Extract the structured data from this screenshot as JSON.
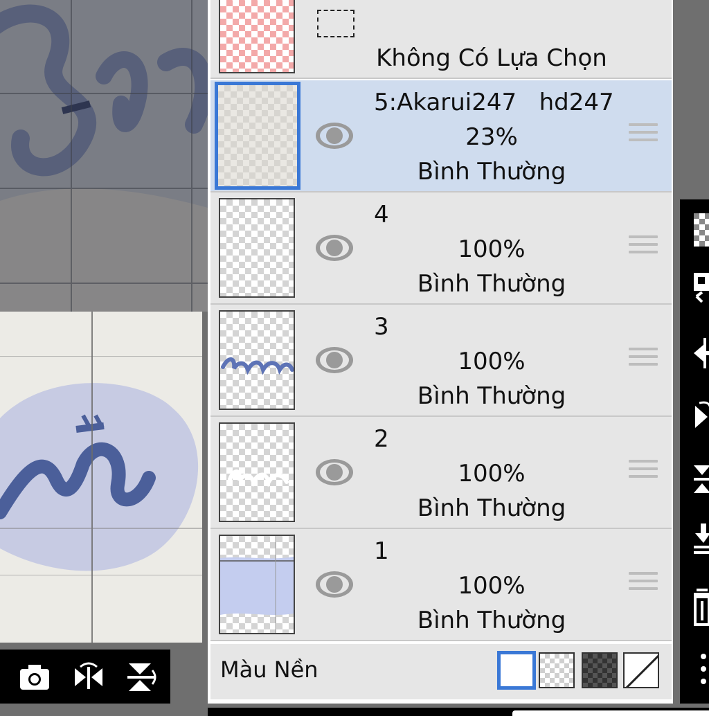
{
  "selection_row": {
    "label": "Không Có Lựa Chọn"
  },
  "layers": [
    {
      "name": "5:Akarui247   hd247",
      "opacity": "23%",
      "blend": "Bình Thường",
      "visible": true,
      "selected": true
    },
    {
      "name": "4",
      "opacity": "100%",
      "blend": "Bình Thường",
      "visible": true,
      "selected": false
    },
    {
      "name": "3",
      "opacity": "100%",
      "blend": "Bình Thường",
      "visible": true,
      "selected": false
    },
    {
      "name": "2",
      "opacity": "100%",
      "blend": "Bình Thường",
      "visible": true,
      "selected": false
    },
    {
      "name": "1",
      "opacity": "100%",
      "blend": "Bình Thường",
      "visible": true,
      "selected": false
    }
  ],
  "background": {
    "label": "Màu Nền",
    "options": [
      "white",
      "transparent-light",
      "transparent-dark",
      "none"
    ],
    "selected": "white"
  },
  "canvas_toolbar": {
    "icons": [
      "camera-icon",
      "flip-horizontal-icon",
      "flip-vertical-icon"
    ]
  },
  "colors": {
    "selection_blue": "#3a78d6",
    "selected_row": "#cfdcee",
    "row_bg": "#e6e6e6"
  }
}
